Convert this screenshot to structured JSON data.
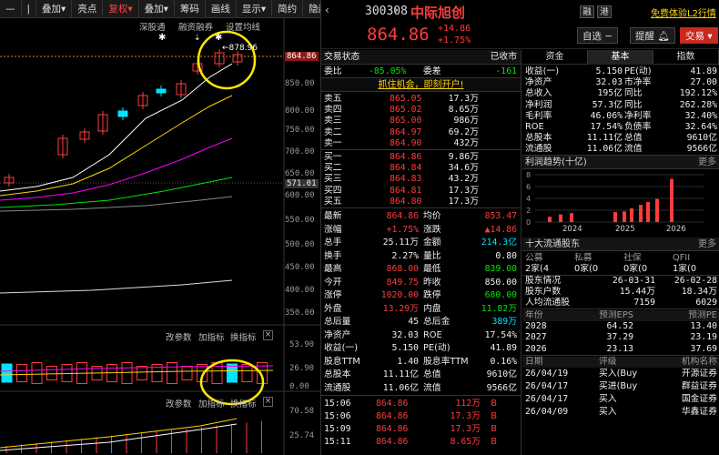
{
  "toolbar": {
    "items": [
      {
        "label": "—",
        "active": false
      },
      {
        "label": "|",
        "active": false
      },
      {
        "label": "叠加▾",
        "active": false
      },
      {
        "label": "亮点",
        "active": false
      },
      {
        "label": "复权▾",
        "active": true
      },
      {
        "label": "叠加▾",
        "active": false
      },
      {
        "label": "筹码",
        "active": false
      },
      {
        "label": "画线",
        "active": false
      },
      {
        "label": "显示▾",
        "active": false
      },
      {
        "label": "简约",
        "active": false
      },
      {
        "label": "隐藏▾",
        "active": false
      }
    ]
  },
  "chart": {
    "top_labels": {
      "a": "深股通",
      "b": "融资融券",
      "c": "设置均线"
    },
    "axis_ticks": [
      "864.86",
      "850.00",
      "800.00",
      "750.00",
      "700.00",
      "650.00",
      "600.00",
      "571.01",
      "550.00",
      "500.00",
      "450.00",
      "400.00",
      "350.00"
    ],
    "high_label": "878.96",
    "last_badge": "864.86",
    "cross_badge": "571.01",
    "sub_bar_labels": {
      "a": "改参数",
      "b": "加指标",
      "c": "换指标"
    },
    "sub_axis": [
      "53.90",
      "26.90",
      "0.00"
    ],
    "sub_axis2": [
      "70.58",
      "25.74"
    ],
    "sub_bar2_labels": {
      "a": "改参数",
      "b": "加指标",
      "c": "换指标"
    },
    "candles_note": "",
    "colors": {
      "up": "#ff3c3c",
      "down": "#00e5ff",
      "ma5": "#ffffff",
      "ma10": "#ffd500",
      "ma20": "#ff00ff",
      "ma60": "#00e600",
      "ma120": "#888888",
      "highlight": "#ffea00"
    }
  },
  "header": {
    "code": "300308",
    "name": "中际旭创",
    "price": "864.86",
    "change": "+14.86",
    "pct": "+1.75%",
    "tag1": "融",
    "tag2": "港",
    "promo": "免费体验L2行情",
    "btn_watch": "自选",
    "btn_alert": "提醒",
    "btn_trade": "交易"
  },
  "quote_panel": {
    "title": "交易状态",
    "status": "已收市",
    "wb_label": "委比",
    "wb_val": "-85.05%",
    "wc_label": "委差",
    "wc_val": "-161",
    "promo": "抓住机会，即刻开户!",
    "asks": [
      {
        "label": "卖五",
        "price": "865.05",
        "vol": "17.3万"
      },
      {
        "label": "卖四",
        "price": "865.02",
        "vol": "8.65万"
      },
      {
        "label": "卖三",
        "price": "865.00",
        "vol": "986万"
      },
      {
        "label": "卖二",
        "price": "864.97",
        "vol": "69.2万"
      },
      {
        "label": "卖一",
        "price": "864.90",
        "vol": "432万"
      }
    ],
    "bids": [
      {
        "label": "买一",
        "price": "864.86",
        "vol": "9.86万"
      },
      {
        "label": "买二",
        "price": "864.84",
        "vol": "34.6万"
      },
      {
        "label": "买三",
        "price": "864.83",
        "vol": "43.2万"
      },
      {
        "label": "买四",
        "price": "864.81",
        "vol": "17.3万"
      },
      {
        "label": "买五",
        "price": "864.80",
        "vol": "17.3万"
      }
    ],
    "stats": [
      {
        "l1": "最新",
        "v1": "864.86",
        "c1": "red",
        "l2": "均价",
        "v2": "853.47",
        "c2": "red"
      },
      {
        "l1": "涨幅",
        "v1": "+1.75%",
        "c1": "red",
        "l2": "涨跌",
        "v2": "▲14.86",
        "c2": "red"
      },
      {
        "l1": "总手",
        "v1": "25.11万",
        "c1": "wht",
        "l2": "金额",
        "v2": "214.3亿",
        "c2": "cyan"
      },
      {
        "l1": "换手",
        "v1": "2.27%",
        "c1": "wht",
        "l2": "量比",
        "v2": "0.80",
        "c2": "wht"
      },
      {
        "l1": "最高",
        "v1": "868.00",
        "c1": "red",
        "l2": "最低",
        "v2": "839.00",
        "c2": "grn"
      },
      {
        "l1": "今开",
        "v1": "849.75",
        "c1": "red",
        "l2": "昨收",
        "v2": "850.00",
        "c2": "wht"
      },
      {
        "l1": "涨停",
        "v1": "1020.00",
        "c1": "red",
        "l2": "跌停",
        "v2": "680.00",
        "c2": "grn"
      },
      {
        "l1": "外盘",
        "v1": "13.29万",
        "c1": "red",
        "l2": "内盘",
        "v2": "11.82万",
        "c2": "grn"
      },
      {
        "l1": "总后量",
        "v1": "45",
        "c1": "wht",
        "l2": "总后金",
        "v2": "389万",
        "c2": "cyan"
      },
      {
        "l1": "净资产",
        "v1": "32.03",
        "c1": "wht",
        "l2": "ROE",
        "v2": "17.54%",
        "c2": "wht"
      },
      {
        "l1": "收益(一)",
        "v1": "5.150",
        "c1": "wht",
        "l2": "PE(动)",
        "v2": "41.89",
        "c2": "wht"
      },
      {
        "l1": "股息TTM",
        "v1": "1.40",
        "c1": "wht",
        "l2": "股息率TTM",
        "v2": "0.16%",
        "c2": "wht"
      },
      {
        "l1": "总股本",
        "v1": "11.11亿",
        "c1": "wht",
        "l2": "总值",
        "v2": "9610亿",
        "c2": "wht"
      },
      {
        "l1": "流通股",
        "v1": "11.06亿",
        "c1": "wht",
        "l2": "流值",
        "v2": "9566亿",
        "c2": "wht"
      }
    ],
    "ticks": [
      {
        "time": "15:06",
        "price": "864.86",
        "vol": "112万",
        "dir": "B"
      },
      {
        "time": "15:06",
        "price": "864.86",
        "vol": "17.3万",
        "dir": "B"
      },
      {
        "time": "15:09",
        "price": "864.86",
        "vol": "17.3万",
        "dir": "B"
      },
      {
        "time": "15:11",
        "price": "864.86",
        "vol": "8.65万",
        "dir": "B"
      }
    ]
  },
  "fin_panel": {
    "tabs": [
      "资金",
      "基本",
      "指数"
    ],
    "active_tab": 1,
    "rows": [
      {
        "l1": "收益(一)",
        "v1": "5.150",
        "l2": "PE(动)",
        "v2": "41.89"
      },
      {
        "l1": "净资产",
        "v1": "32.03",
        "l2": "市净率",
        "v2": "27.00"
      },
      {
        "l1": "总收入",
        "v1": "195亿",
        "l2": "同比",
        "v2": "192.12%"
      },
      {
        "l1": "净利润",
        "v1": "57.3亿",
        "l2": "同比",
        "v2": "262.28%"
      },
      {
        "l1": "毛利率",
        "v1": "46.06%",
        "l2": "净利率",
        "v2": "32.40%"
      },
      {
        "l1": "ROE",
        "v1": "17.54%",
        "l2": "负债率",
        "v2": "32.64%"
      },
      {
        "l1": "总股本",
        "v1": "11.11亿",
        "l2": "总值",
        "v2": "9610亿"
      },
      {
        "l1": "流通股",
        "v1": "11.06亿",
        "l2": "流值",
        "v2": "9566亿"
      }
    ],
    "trend_title": "利润趋势(十亿)",
    "more": "更多",
    "trend_axis": [
      "8",
      "6",
      "4",
      "2",
      "0"
    ],
    "trend_years": [
      "2024",
      "2025",
      "2026"
    ],
    "trend_values": [
      0.9,
      1.3,
      1.5,
      1.7,
      1.8,
      2.3,
      2.9,
      3.4,
      3.9,
      7.3
    ],
    "holders_title": "十大流通股东",
    "holders_cols": [
      "公募",
      "私募",
      "社保",
      "QFII"
    ],
    "holders_vals": [
      "2家(4",
      "0家(0",
      "0家(0",
      "1家(0"
    ],
    "holders_rows": [
      {
        "l": "股东情况",
        "v1": "26-03-31",
        "v2": "26-02-28"
      },
      {
        "l": "股东户数",
        "v1": "15.44万",
        "v2": "18.34万"
      },
      {
        "l": "人均流通股",
        "v1": "7159",
        "v2": "6029"
      }
    ],
    "forecast_cols": [
      "年份",
      "预测EPS",
      "预测PE"
    ],
    "forecast": [
      {
        "y": "2028",
        "eps": "64.52",
        "pe": "13.40"
      },
      {
        "y": "2027",
        "eps": "37.29",
        "pe": "23.19"
      },
      {
        "y": "2026",
        "eps": "23.13",
        "pe": "37.69"
      }
    ],
    "rating_cols": [
      "日期",
      "评级",
      "机构名称"
    ],
    "ratings": [
      {
        "d": "26/04/19",
        "r": "买入(Buy",
        "o": "开源证券"
      },
      {
        "d": "26/04/17",
        "r": "买进(Buy",
        "o": "群益证券"
      },
      {
        "d": "26/04/17",
        "r": "买入",
        "o": "国金证券"
      },
      {
        "d": "26/04/09",
        "r": "买入",
        "o": "华鑫证券"
      }
    ]
  }
}
